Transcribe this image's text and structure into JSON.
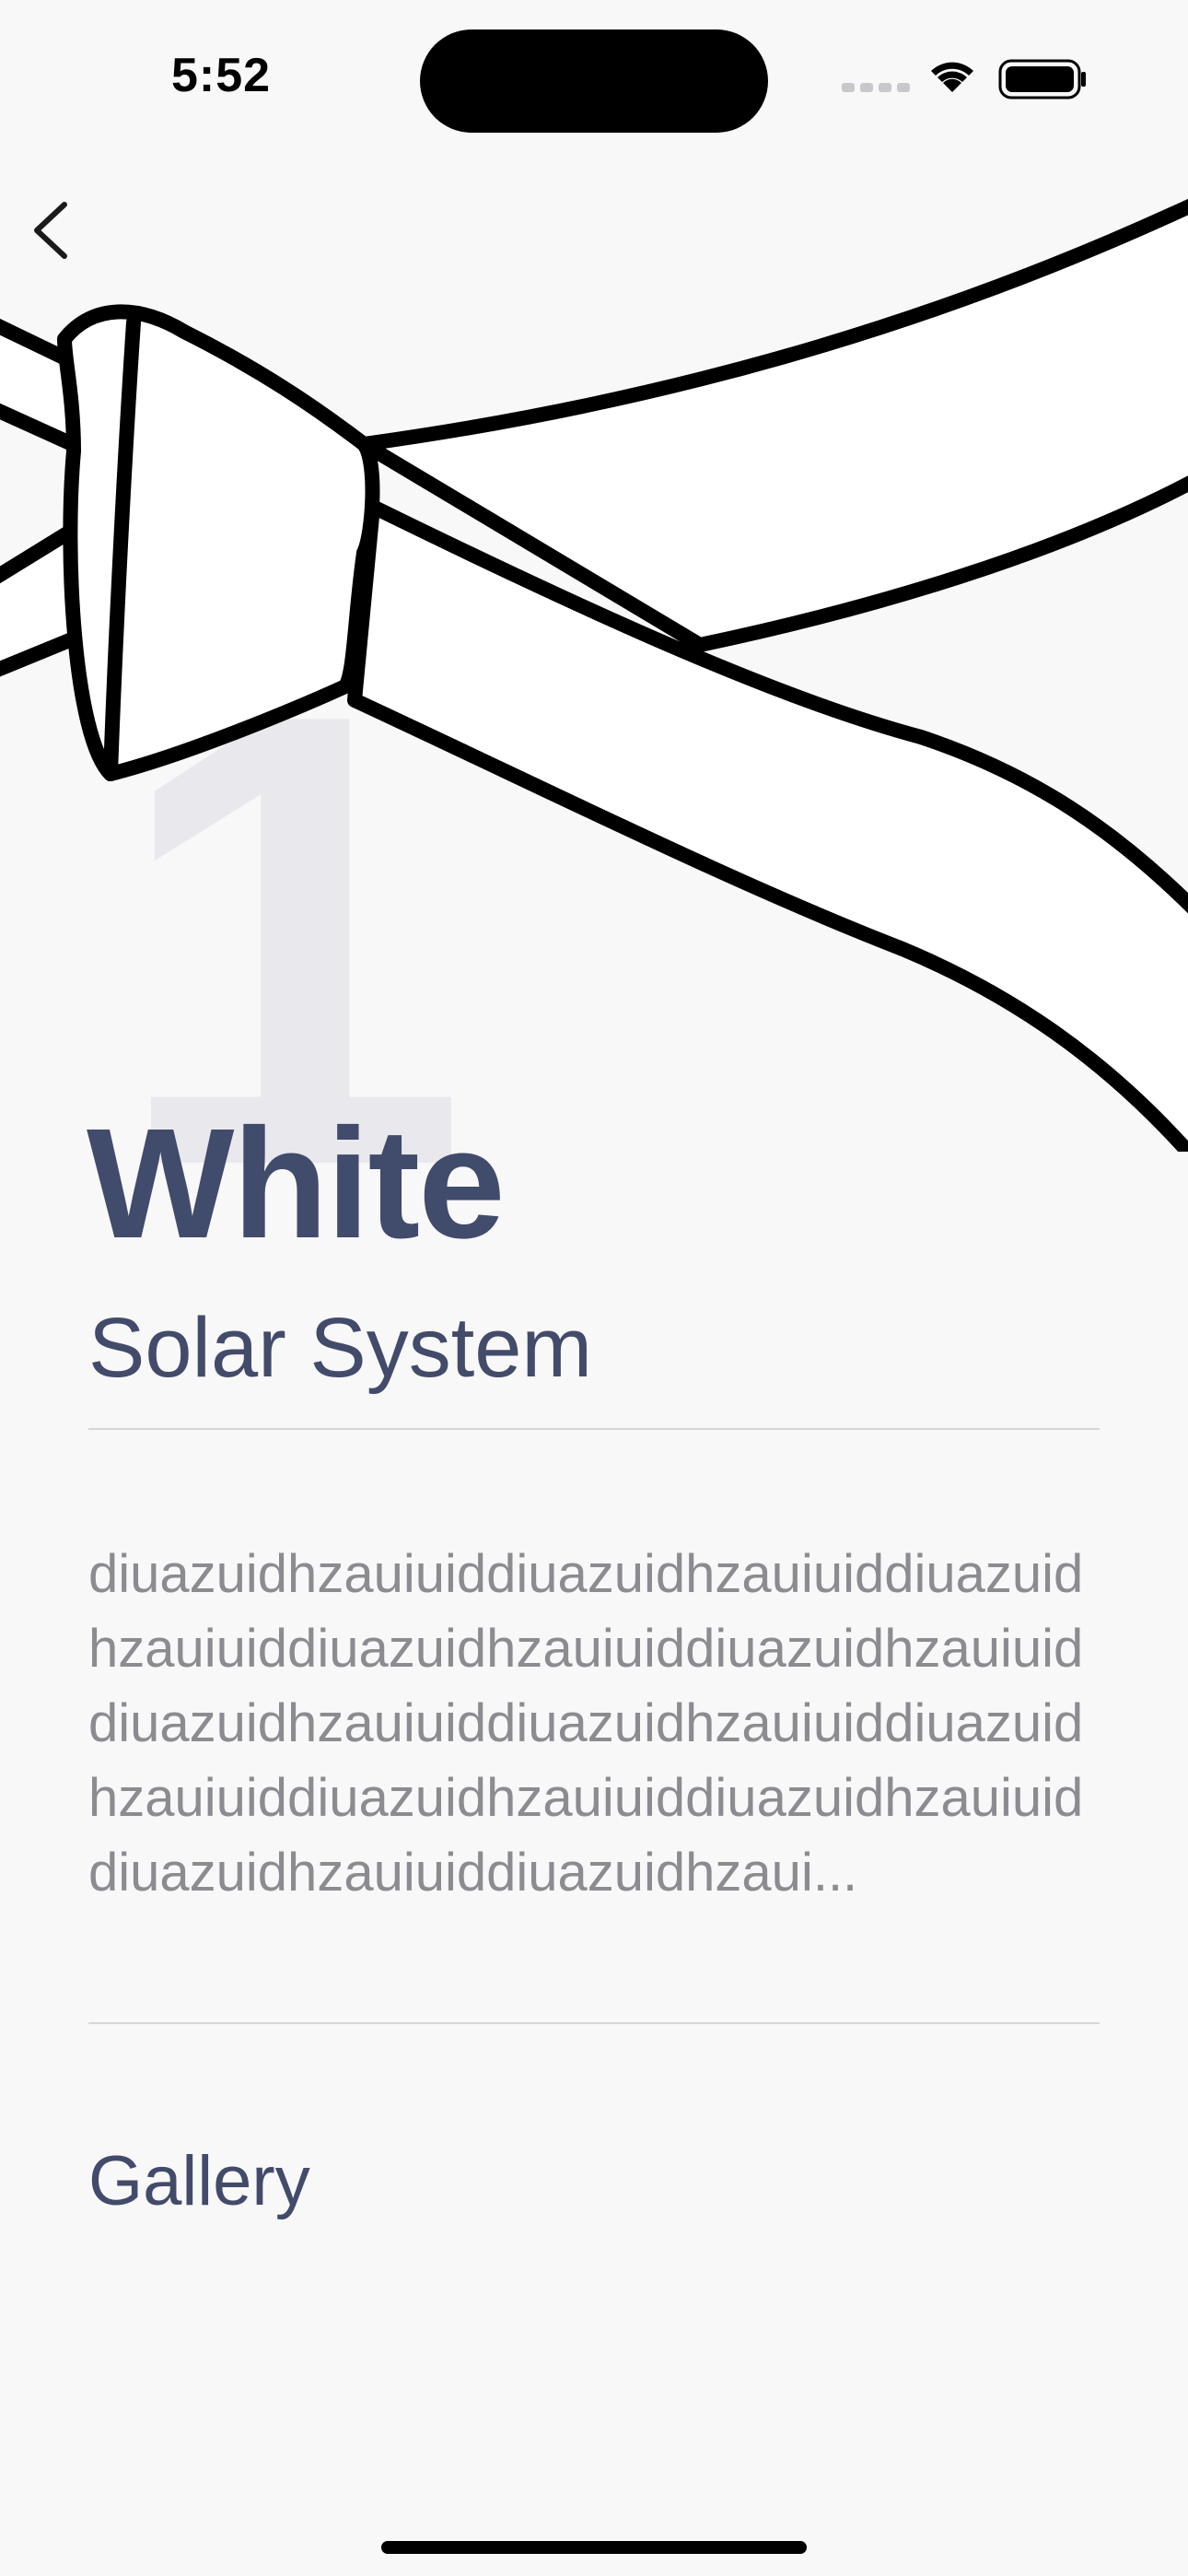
{
  "status_bar": {
    "time": "5:52"
  },
  "navigation": {
    "back_icon": "chevron-left-icon"
  },
  "hero": {
    "rank_number": "1",
    "image": "white-belt-knot-illustration"
  },
  "belt": {
    "title": "White",
    "subtitle": "Solar System",
    "description": "diuazuidhzauiuiddiuazuidhzauiuiddiuazuidhzauiuiddiuazuidhzauiuiddiuazuidhzauiuiddiuazuidhzauiuiddiuazuidhzauiuiddiuazuidhzauiuiddiuazuidhzauiuiddiuazuidhzauiuiddiuazuidhzauiuiddiuazuidhzaui..."
  },
  "sections": {
    "gallery_label": "Gallery"
  },
  "colors": {
    "background": "#f8f8f9",
    "title": "#414b6b",
    "description": "#8b8b90",
    "rank_number": "#e9e9ed"
  }
}
